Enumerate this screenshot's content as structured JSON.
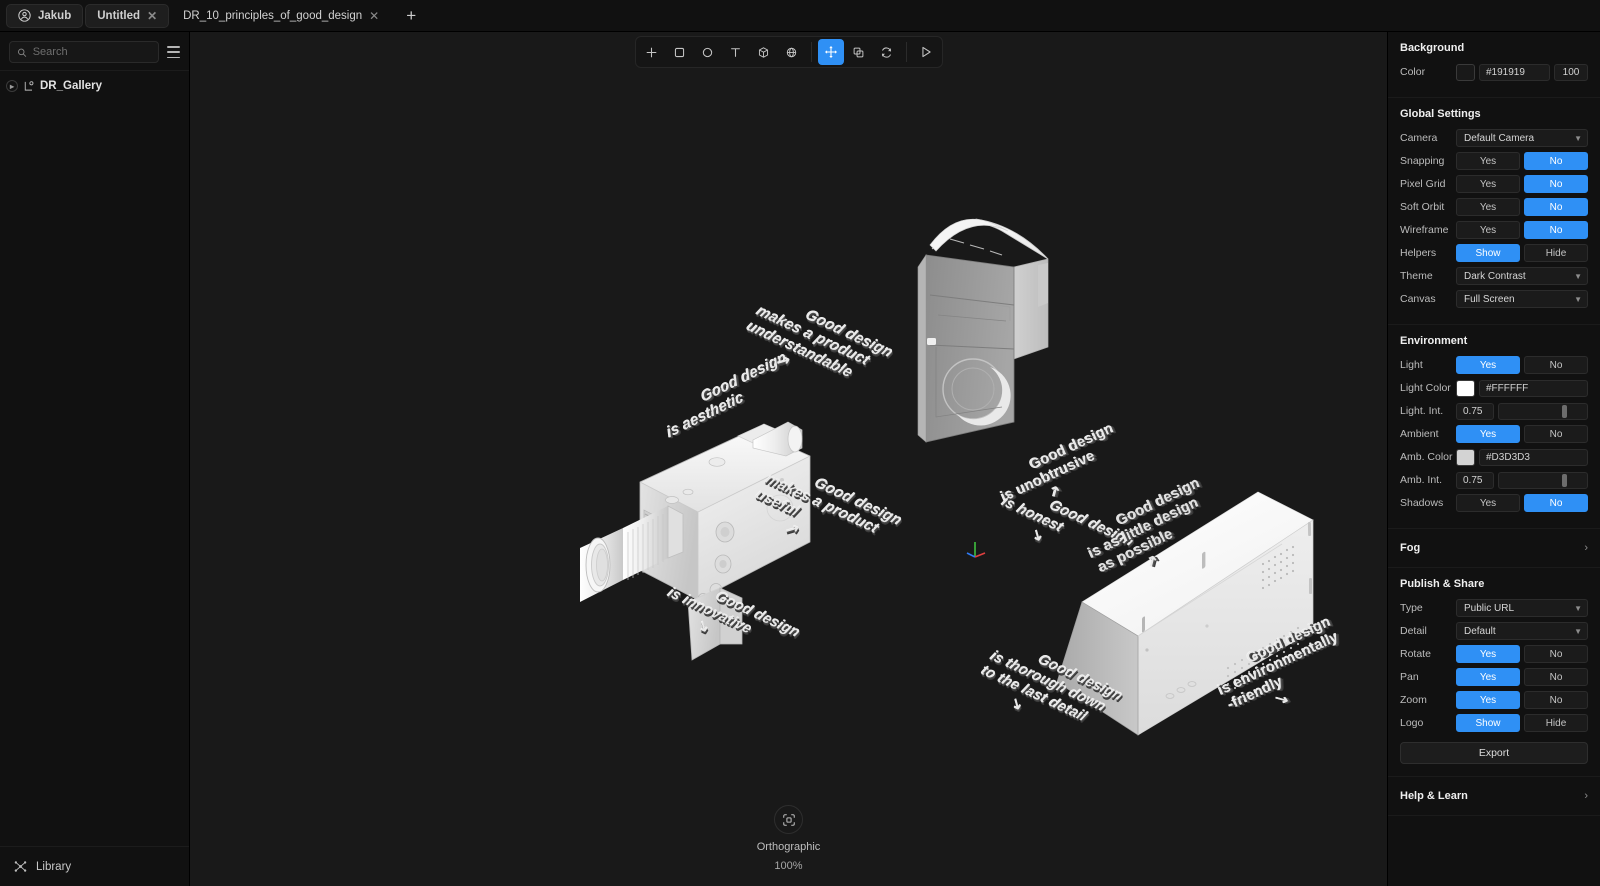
{
  "tabs": {
    "account": "Jakub",
    "items": [
      {
        "label": "Untitled",
        "active": true,
        "closable": true
      },
      {
        "label": "DR_10_principles_of_good_design",
        "active": false,
        "closable": true
      }
    ],
    "new_tab": "+"
  },
  "sidebar": {
    "search_placeholder": "Search",
    "search_value": "",
    "tree": [
      {
        "label": "DR_Gallery"
      }
    ],
    "footer": {
      "label": "Library"
    }
  },
  "toolbar": {
    "tools": [
      {
        "name": "add",
        "glyph": "+",
        "selected": false
      },
      {
        "name": "rectangle",
        "glyph": "square",
        "selected": false
      },
      {
        "name": "ellipse",
        "glyph": "circle",
        "selected": false
      },
      {
        "name": "text",
        "glyph": "T",
        "selected": false
      },
      {
        "name": "cube",
        "glyph": "cube",
        "selected": false
      },
      {
        "name": "sphere",
        "glyph": "sphere",
        "selected": false
      },
      {
        "name": "move",
        "glyph": "move",
        "selected": true
      },
      {
        "name": "duplicate",
        "glyph": "copy",
        "selected": false
      },
      {
        "name": "rotate",
        "glyph": "refresh",
        "selected": false
      },
      {
        "name": "play",
        "glyph": "play",
        "selected": false
      }
    ]
  },
  "viewport": {
    "projection": "Orthographic",
    "zoom": "100%",
    "labels": [
      {
        "id": "aesthetic",
        "text": "Good design\nis aesthetic",
        "arrow": false
      },
      {
        "id": "understandable",
        "text": "Good design\nmakes a product\nunderstandable",
        "arrow": true
      },
      {
        "id": "useful",
        "text": "Good design\nmakes a product\nuseful",
        "arrow": true
      },
      {
        "id": "innovative",
        "text": "Good design\nis innovative",
        "arrow": true
      },
      {
        "id": "unobtrusive",
        "text": "Good design\nis unobtrusive",
        "arrow": true
      },
      {
        "id": "honest",
        "text": "Good design\nis honest",
        "arrow": true
      },
      {
        "id": "little-design",
        "text": "Good design\nis as little design\nas possible",
        "arrow": true
      },
      {
        "id": "thorough",
        "text": "Good design\nis thorough down\nto the last detail",
        "arrow": true
      },
      {
        "id": "environmental",
        "text": "Good design\nis environmentally\n-friendly",
        "arrow": true
      }
    ]
  },
  "panel": {
    "background": {
      "title": "Background",
      "color_label": "Color",
      "color_hex": "#191919",
      "color_swatch": "#191919",
      "opacity": "100"
    },
    "global": {
      "title": "Global Settings",
      "camera_label": "Camera",
      "camera_value": "Default Camera",
      "snapping_label": "Snapping",
      "snapping_yes": "Yes",
      "snapping_no": "No",
      "snapping_value": "No",
      "pixelgrid_label": "Pixel Grid",
      "pixelgrid_yes": "Yes",
      "pixelgrid_no": "No",
      "pixelgrid_value": "No",
      "softorbit_label": "Soft Orbit",
      "softorbit_yes": "Yes",
      "softorbit_no": "No",
      "softorbit_value": "No",
      "wireframe_label": "Wireframe",
      "wireframe_yes": "Yes",
      "wireframe_no": "No",
      "wireframe_value": "No",
      "helpers_label": "Helpers",
      "helpers_show": "Show",
      "helpers_hide": "Hide",
      "helpers_value": "Show",
      "theme_label": "Theme",
      "theme_value": "Dark Contrast",
      "canvas_label": "Canvas",
      "canvas_value": "Full Screen"
    },
    "environment": {
      "title": "Environment",
      "light_label": "Light",
      "light_yes": "Yes",
      "light_no": "No",
      "light_value": "Yes",
      "light_color_label": "Light Color",
      "light_color_hex": "#FFFFFF",
      "light_color_swatch": "#FFFFFF",
      "light_int_label": "Light. Int.",
      "light_int_value": "0.75",
      "ambient_label": "Ambient",
      "ambient_yes": "Yes",
      "ambient_no": "No",
      "ambient_value": "Yes",
      "amb_color_label": "Amb. Color",
      "amb_color_hex": "#D3D3D3",
      "amb_color_swatch": "#D3D3D3",
      "amb_int_label": "Amb. Int.",
      "amb_int_value": "0.75",
      "shadows_label": "Shadows",
      "shadows_yes": "Yes",
      "shadows_no": "No",
      "shadows_value": "No"
    },
    "fog": {
      "title": "Fog"
    },
    "publish": {
      "title": "Publish & Share",
      "type_label": "Type",
      "type_value": "Public URL",
      "detail_label": "Detail",
      "detail_value": "Default",
      "rotate_label": "Rotate",
      "rotate_yes": "Yes",
      "rotate_no": "No",
      "rotate_value": "Yes",
      "pan_label": "Pan",
      "pan_yes": "Yes",
      "pan_no": "No",
      "pan_value": "Yes",
      "zoom_label": "Zoom",
      "zoom_yes": "Yes",
      "zoom_no": "No",
      "zoom_value": "Yes",
      "logo_label": "Logo",
      "logo_show": "Show",
      "logo_hide": "Hide",
      "logo_value": "Show",
      "export_label": "Export"
    },
    "help": {
      "title": "Help & Learn"
    }
  },
  "colors": {
    "accent": "#2f90f5",
    "canvas_bg": "#191919",
    "chrome_bg": "#111111"
  }
}
